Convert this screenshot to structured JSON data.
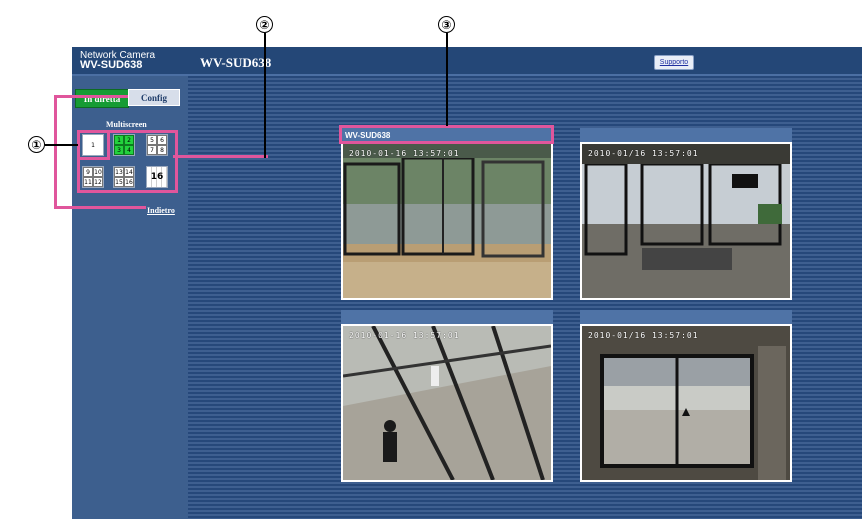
{
  "callouts": [
    "①",
    "②",
    "③"
  ],
  "header": {
    "brand_small": "Network Camera",
    "brand_model": "WV-SUD638",
    "title": "WV-SUD638",
    "support_label": "Supporto"
  },
  "sidebar": {
    "live_label": "In diretta",
    "config_label": "Config",
    "multiscreen_label": "Multiscreen",
    "back_label": "Indietro",
    "tiles": {
      "single": [
        "1"
      ],
      "quad_a": [
        "1",
        "2",
        "3",
        "4"
      ],
      "quad_b": [
        "5",
        "6",
        "7",
        "8"
      ],
      "quad_c": [
        "9",
        "10",
        "11",
        "12"
      ],
      "quad_d": [
        "13",
        "14",
        "15",
        "16"
      ],
      "grid16": "16"
    }
  },
  "panels": [
    {
      "title": "WV-SUD638",
      "timestamp": "2010-01-16 13:57:01"
    },
    {
      "title": "",
      "timestamp": "2010-01/16 13:57:01"
    },
    {
      "title": "",
      "timestamp": "2010-01-16 13:57:01"
    },
    {
      "title": "",
      "timestamp": "2010-01/16 13:57:01"
    }
  ]
}
